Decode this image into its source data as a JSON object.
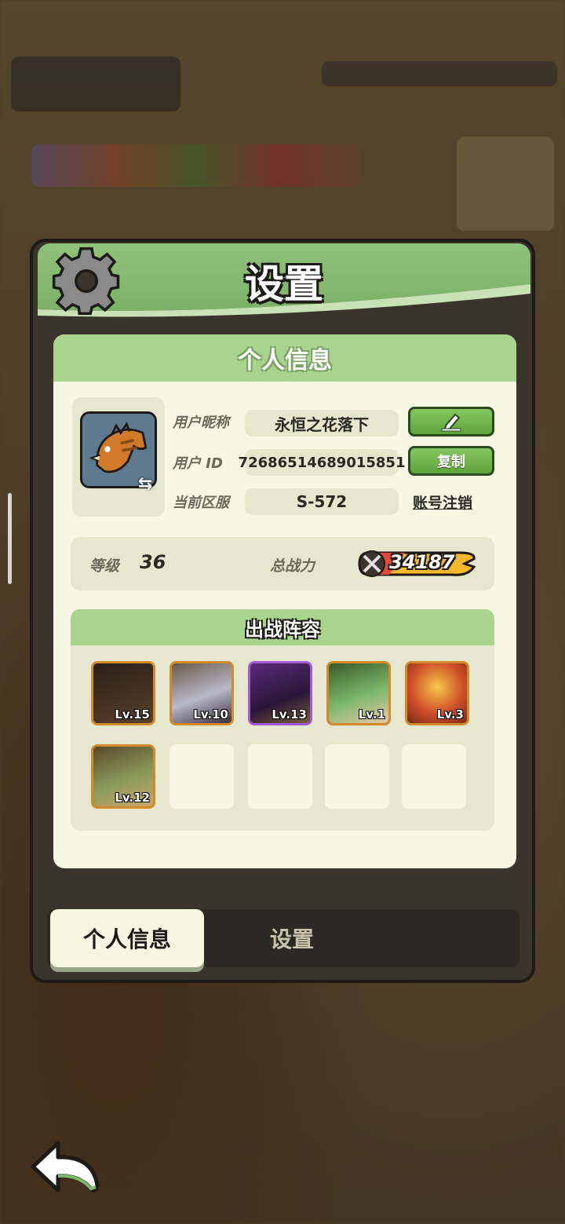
{
  "panel": {
    "title": "设置",
    "section_title": "个人信息"
  },
  "profile": {
    "nickname_label": "用户昵称",
    "nickname_value": "永恒之花落下",
    "edit_icon": "pencil-icon",
    "id_label": "用户 ID",
    "id_value": "72686514689015851",
    "copy_label": "复制",
    "server_label": "当前区服",
    "server_value": "S-572",
    "deregister_label": "账号注销"
  },
  "stats": {
    "level_label": "等级",
    "level_value": "36",
    "power_label": "总战力",
    "power_value": "34187"
  },
  "lineup": {
    "title": "出战阵容",
    "heroes": [
      {
        "level": "Lv.15",
        "frame": "gold",
        "color": "#3b2a1c"
      },
      {
        "level": "Lv.10",
        "frame": "gold",
        "color": "#4b4a58"
      },
      {
        "level": "Lv.13",
        "frame": "purple",
        "color": "#4a2a62"
      },
      {
        "level": "Lv.1",
        "frame": "gold",
        "color": "#4e6b3a"
      },
      {
        "level": "Lv.3",
        "frame": "gold",
        "color": "#b8542a"
      },
      {
        "level": "Lv.12",
        "frame": "gold",
        "color": "#6b5a2a"
      }
    ],
    "empty_slots": 4
  },
  "tabs": {
    "active": "个人信息",
    "inactive": "设置"
  },
  "colors": {
    "header_green": "#8fc27a",
    "button_green": "#6fb14b",
    "panel_dark": "#3a342c",
    "card_bg": "#f6f8e4"
  }
}
